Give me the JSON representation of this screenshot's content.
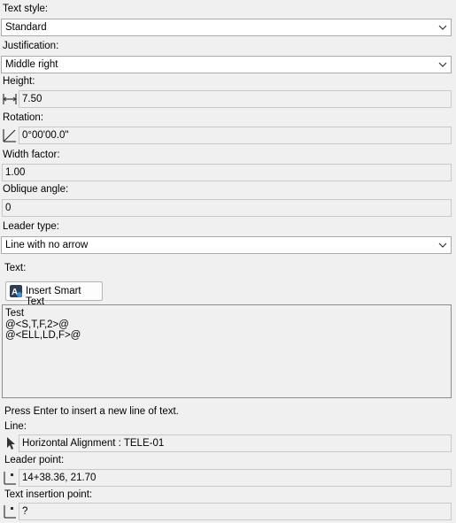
{
  "text_style": {
    "label": "Text style:",
    "value": "Standard"
  },
  "justification": {
    "label": "Justification:",
    "value": "Middle right"
  },
  "height": {
    "label": "Height:",
    "value": "7.50"
  },
  "rotation": {
    "label": "Rotation:",
    "value": "0°00'00.0\""
  },
  "width_factor": {
    "label": "Width factor:",
    "value": "1.00"
  },
  "oblique_angle": {
    "label": "Oblique angle:",
    "value": "0"
  },
  "leader_type": {
    "label": "Leader type:",
    "value": "Line with no arrow"
  },
  "text": {
    "label": "Text:",
    "insert_smart_text": "Insert Smart Text",
    "lines": [
      "Test",
      "@<S,T,F,2>@",
      "@<ELL,LD,F>@"
    ]
  },
  "hint": "Press Enter to insert a new line of text.",
  "line": {
    "label": "Line:",
    "value": "Horizontal Alignment : TELE-01"
  },
  "leader_point": {
    "label": "Leader point:",
    "value": "14+38.36, 21.70"
  },
  "text_insertion_point": {
    "label": "Text insertion point:",
    "value": "?"
  }
}
